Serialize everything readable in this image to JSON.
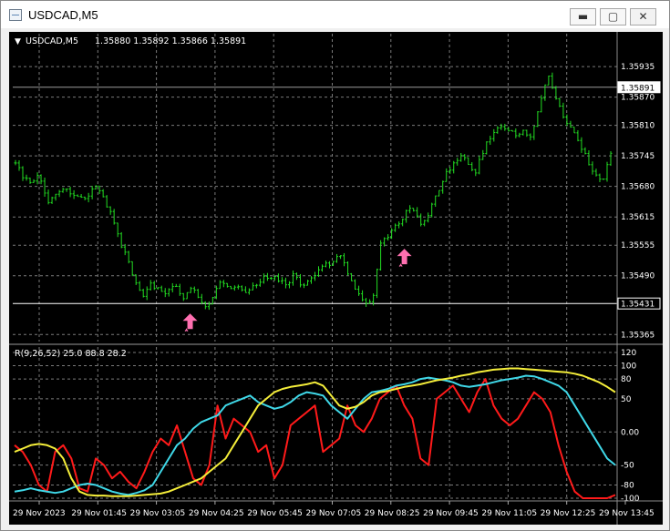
{
  "window": {
    "title": "USDCAD,M5",
    "min_glyph": "▬",
    "max_glyph": "▢",
    "close_glyph": "✕"
  },
  "price_panel": {
    "header_arrow": "▼",
    "symbol": "USDCAD,M5",
    "ohlc": "1.35880 1.35892 1.35866 1.35891",
    "bid_price": "1.35891",
    "line_price": "1.35431"
  },
  "indicator_panel": {
    "header": "R(9,26,52) 25.0 88.8 28.2"
  },
  "colors": {
    "background": "#000000",
    "grid": "#7a7a7a",
    "candles": "#22dd22",
    "series_1": "#ff1a1a",
    "series_2": "#3fd8e8",
    "series_3": "#f5ee3a",
    "arrows": "#ff6fb0"
  },
  "chart_data": [
    {
      "type": "candlestick",
      "y_ticks": [
        "1.35935",
        "1.35870",
        "1.35810",
        "1.35745",
        "1.35680",
        "1.35615",
        "1.35555",
        "1.35490",
        "1.35365"
      ],
      "ylim": [
        1.3535,
        1.3597
      ],
      "horizontal_lines": [
        1.35891,
        1.35431
      ],
      "close_path": [
        1.3573,
        1.357,
        1.3569,
        1.3571,
        1.3565,
        1.3566,
        1.3567,
        1.3567,
        1.3565,
        1.3566,
        1.3568,
        1.3566,
        1.3562,
        1.3557,
        1.3553,
        1.3548,
        1.3545,
        1.3547,
        1.3546,
        1.3545,
        1.3547,
        1.3544,
        1.3546,
        1.3545,
        1.3542,
        1.3545,
        1.3548,
        1.3546,
        1.3547,
        1.3546,
        1.3547,
        1.3548,
        1.3549,
        1.3548,
        1.3547,
        1.3549,
        1.3547,
        1.3548,
        1.355,
        1.3551,
        1.3552,
        1.3553,
        1.3549,
        1.3546,
        1.3543,
        1.3544,
        1.3556,
        1.3557,
        1.356,
        1.3562,
        1.3564,
        1.356,
        1.3562,
        1.3566,
        1.357,
        1.3572,
        1.3575,
        1.3573,
        1.3571,
        1.3576,
        1.3579,
        1.3581,
        1.358,
        1.3579,
        1.358,
        1.3578,
        1.3585,
        1.3592,
        1.3587,
        1.3583,
        1.358,
        1.3577,
        1.3574,
        1.357,
        1.3569,
        1.3575
      ],
      "arrow_markers": [
        {
          "x_index": 22,
          "price": 1.35425
        },
        {
          "x_index": 49,
          "price": 1.35563
        }
      ]
    },
    {
      "type": "line",
      "y_ticks": [
        "120",
        "100",
        "80",
        "50",
        "0.00",
        "-50",
        "-80",
        "-100"
      ],
      "ylim": [
        -100,
        120
      ],
      "x_tick_labels": [
        "29 Nov 2023",
        "29 Nov 01:45",
        "29 Nov 03:05",
        "29 Nov 04:25",
        "29 Nov 05:45",
        "29 Nov 07:05",
        "29 Nov 08:25",
        "29 Nov 09:45",
        "29 Nov 11:05",
        "29 Nov 12:25",
        "29 Nov 13:45"
      ],
      "series": [
        {
          "values": [
            -20,
            -30,
            -50,
            -80,
            -90,
            -30,
            -20,
            -40,
            -85,
            -90,
            -40,
            -50,
            -70,
            -60,
            -75,
            -85,
            -60,
            -30,
            -10,
            -20,
            10,
            -30,
            -70,
            -80,
            -50,
            40,
            -10,
            20,
            10,
            0,
            -30,
            -20,
            -70,
            -50,
            10,
            20,
            30,
            40,
            -30,
            -20,
            -10,
            40,
            10,
            0,
            20,
            50,
            60,
            70,
            40,
            20,
            -40,
            -50,
            50,
            60,
            70,
            50,
            30,
            60,
            80,
            40,
            20,
            10,
            20,
            40,
            60,
            50,
            30,
            -20,
            -60,
            -90,
            -100,
            -100,
            -100,
            -100,
            -95
          ]
        },
        {
          "values": [
            -90,
            -88,
            -85,
            -88,
            -90,
            -92,
            -90,
            -85,
            -80,
            -78,
            -80,
            -85,
            -90,
            -93,
            -95,
            -92,
            -88,
            -80,
            -60,
            -40,
            -20,
            -10,
            5,
            15,
            20,
            25,
            40,
            45,
            50,
            55,
            45,
            40,
            35,
            38,
            45,
            55,
            60,
            58,
            55,
            40,
            30,
            20,
            35,
            50,
            60,
            62,
            65,
            70,
            72,
            75,
            80,
            82,
            80,
            78,
            75,
            70,
            68,
            70,
            72,
            75,
            78,
            80,
            82,
            85,
            84,
            80,
            75,
            70,
            60,
            40,
            20,
            0,
            -20,
            -40,
            -50
          ]
        },
        {
          "values": [
            -30,
            -25,
            -20,
            -18,
            -20,
            -25,
            -40,
            -70,
            -90,
            -95,
            -96,
            -96,
            -97,
            -97,
            -97,
            -96,
            -95,
            -94,
            -93,
            -90,
            -85,
            -80,
            -75,
            -70,
            -60,
            -50,
            -40,
            -20,
            0,
            20,
            40,
            50,
            60,
            65,
            68,
            70,
            72,
            75,
            70,
            55,
            40,
            35,
            38,
            45,
            55,
            60,
            62,
            65,
            68,
            70,
            72,
            75,
            78,
            80,
            82,
            85,
            87,
            90,
            92,
            94,
            95,
            96,
            96,
            95,
            94,
            93,
            92,
            91,
            90,
            88,
            85,
            80,
            75,
            68,
            60
          ]
        }
      ]
    }
  ]
}
